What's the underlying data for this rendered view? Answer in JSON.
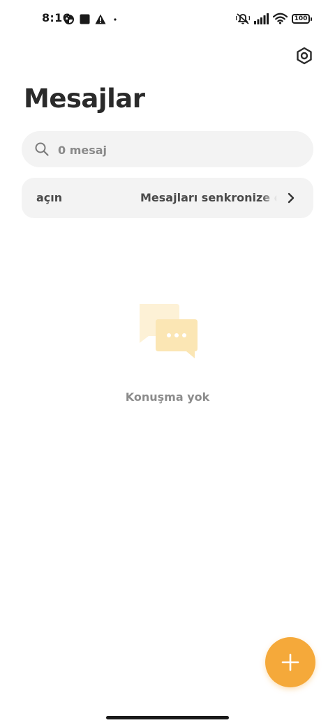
{
  "status_bar": {
    "time": "8:16",
    "battery_level": "100",
    "icons": [
      "data-saver-icon",
      "square-notification-icon",
      "warning-icon",
      "dot-icon",
      "silent-mode-icon",
      "signal-icon",
      "wifi-icon",
      "battery-icon"
    ]
  },
  "header": {
    "title": "Mesajlar",
    "settings_icon": "hexagon-settings-icon"
  },
  "search": {
    "placeholder": "0 mesaj",
    "value": ""
  },
  "sync_banner": {
    "action": "açın",
    "label": "Mesajları senkronize et"
  },
  "empty_state": {
    "text": "Konuşma yok",
    "icon": "chat-bubbles-icon"
  },
  "fab": {
    "icon": "plus-icon"
  },
  "colors": {
    "accent": "#f5a93a",
    "surface": "#f3f3f3",
    "title": "#2a2a2a",
    "muted_text": "#8c8c8c",
    "illustration_light": "#fdf1d6",
    "illustration_mid": "#fbe6b4"
  }
}
